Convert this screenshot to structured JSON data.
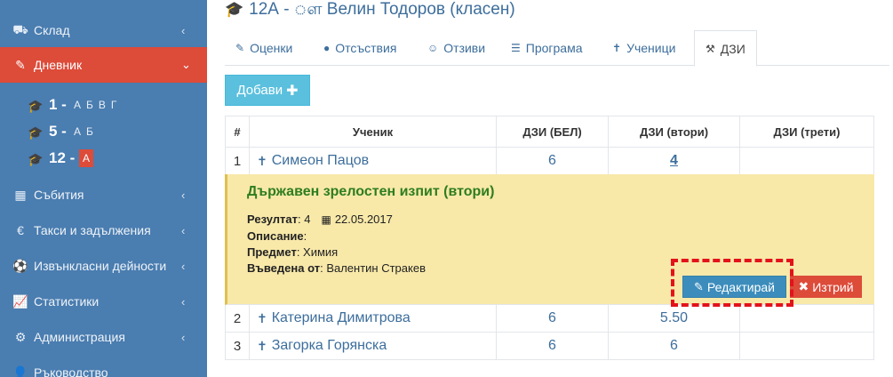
{
  "sidebar": {
    "items": [
      {
        "label": "Склад",
        "icon": "cart-icon"
      },
      {
        "label": "Дневник",
        "icon": "edit-icon",
        "active": true
      },
      {
        "label": "Събития",
        "icon": "calendar-icon"
      },
      {
        "label": "Такси и задължения",
        "icon": "euro-icon"
      },
      {
        "label": "Извънкласни дейности",
        "icon": "soccer-ball-icon"
      },
      {
        "label": "Статистики",
        "icon": "line-chart-icon"
      },
      {
        "label": "Администрация",
        "icon": "cogs-icon"
      },
      {
        "label": "Ръководство",
        "icon": "user-icon"
      }
    ],
    "grades": [
      {
        "grade": "1 -",
        "letters": [
          "А",
          "Б",
          "В",
          "Г"
        ]
      },
      {
        "grade": "5 -",
        "letters": [
          "А",
          "Б"
        ]
      },
      {
        "grade": "12 -",
        "letters": [
          "А"
        ],
        "active_letter": "А"
      }
    ]
  },
  "header": {
    "title": "12А - ௗ Велин Тодоров (класен)"
  },
  "tabs": [
    {
      "label": "Оценки",
      "icon": "pencil-icon"
    },
    {
      "label": "Отсъствия",
      "icon": "exclamation-icon"
    },
    {
      "label": "Отзиви",
      "icon": "smile-icon"
    },
    {
      "label": "Програма",
      "icon": "list-icon"
    },
    {
      "label": "Ученици",
      "icon": "child-icon"
    },
    {
      "label": "ДЗИ",
      "icon": "gavel-icon",
      "active": true
    }
  ],
  "toolbar": {
    "add_label": "Добави",
    "add_plus": "✚"
  },
  "table": {
    "headers": [
      "#",
      "Ученик",
      "ДЗИ (БЕЛ)",
      "ДЗИ (втори)",
      "ДЗИ (трети)"
    ],
    "rows": [
      {
        "num": "1",
        "name": "Симеон Пацов",
        "bel": "6",
        "second": "4",
        "third": ""
      },
      {
        "num": "2",
        "name": "Катерина Димитрова",
        "bel": "6",
        "second": "5.50",
        "third": ""
      },
      {
        "num": "3",
        "name": "Загорка Горянска",
        "bel": "6",
        "second": "6",
        "third": ""
      }
    ]
  },
  "detail": {
    "title": "Държавен зрелостен изпит (втори)",
    "result_label": "Резултат",
    "result_value": "4",
    "date": "22.05.2017",
    "description_label": "Описание",
    "description_value": "",
    "subject_label": "Предмет",
    "subject_value": "Химия",
    "entered_by_label": "Въведена от",
    "entered_by_value": "Валентин Стракев",
    "edit_label": "Редактирай",
    "delete_label": "Изтрий"
  },
  "colors": {
    "sidebar_bg": "#4a7db0",
    "active_red": "#dd4b39",
    "link_blue": "#3d6e9c",
    "info_button": "#5bc0de",
    "detail_bg": "#f8e9a9",
    "detail_title": "#2e7d1f",
    "highlight": "#e3121b"
  }
}
